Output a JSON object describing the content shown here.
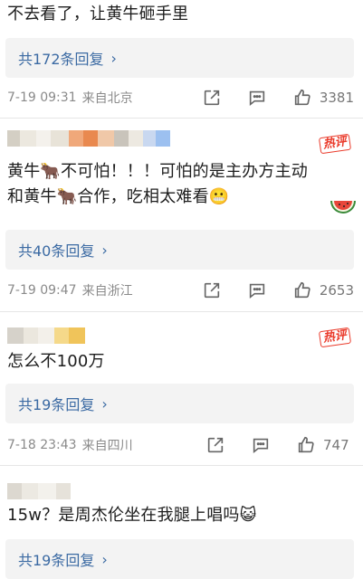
{
  "comments": [
    {
      "text": "不去看了，让黄牛砸手里",
      "reply_label": "共172条回复",
      "time": "7-19 09:31",
      "location": "来自北京",
      "likes": "3381"
    },
    {
      "line1": "黄牛🐂不可怕！！！可怕的是主办方主动",
      "line2": "和黄牛🐂合作，吃相太难看😬",
      "hot_badge": "热评",
      "reply_label": "共40条回复",
      "time": "7-19 09:47",
      "location": "来自浙江",
      "likes": "2653"
    },
    {
      "text": "怎么不100万",
      "hot_badge": "热评",
      "reply_label": "共19条回复",
      "time": "7-18 23:43",
      "location": "来自四川",
      "likes": "747"
    },
    {
      "text": "15w？是周杰伦坐在我腿上唱吗😺",
      "reply_label": "共19条回复"
    }
  ],
  "icons": {
    "share": "share-icon",
    "comment": "comment-icon",
    "like": "thumb-up-icon",
    "chevron": "chevron-right-icon"
  },
  "colors": {
    "link": "#3b6aa3",
    "meta": "#8a8a8a",
    "hot": "#ea3a2a",
    "reply_bg": "#f3f3f3"
  }
}
